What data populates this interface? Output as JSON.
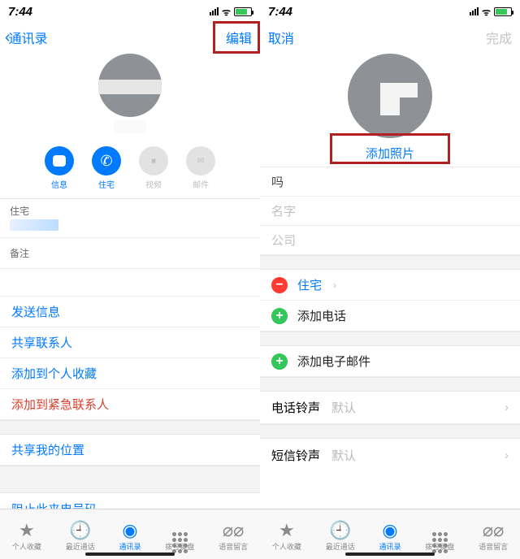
{
  "status": {
    "time": "7:44",
    "wifi": "􀙇",
    "bolt": "⚡︎"
  },
  "left": {
    "nav": {
      "back": "通讯录",
      "edit": "编辑"
    },
    "actions": {
      "msg": "信息",
      "home": "住宅",
      "video": "视频",
      "mail": "邮件"
    },
    "section_home": "住宅",
    "section_notes": "备注",
    "links": {
      "sendmsg": "发送信息",
      "share": "共享联系人",
      "fav": "添加到个人收藏",
      "emergency": "添加到紧急联系人",
      "loc": "共享我的位置",
      "block": "阻止此来电号码"
    }
  },
  "right": {
    "nav": {
      "cancel": "取消",
      "done": "完成"
    },
    "addphoto": "添加照片",
    "fields": {
      "surname_partial": "吗",
      "name": "名字",
      "company": "公司"
    },
    "phone": {
      "home": "住宅",
      "add": "添加电话"
    },
    "email": {
      "add": "添加电子邮件"
    },
    "ringtone": {
      "label": "电话铃声",
      "value": "默认"
    },
    "texttone": {
      "label": "短信铃声",
      "value": "默认"
    }
  },
  "tabs": {
    "fav": "个人收藏",
    "recent": "最近通话",
    "contacts": "通讯录",
    "keypad": "拨号键盘",
    "voicemail": "语音留言"
  }
}
